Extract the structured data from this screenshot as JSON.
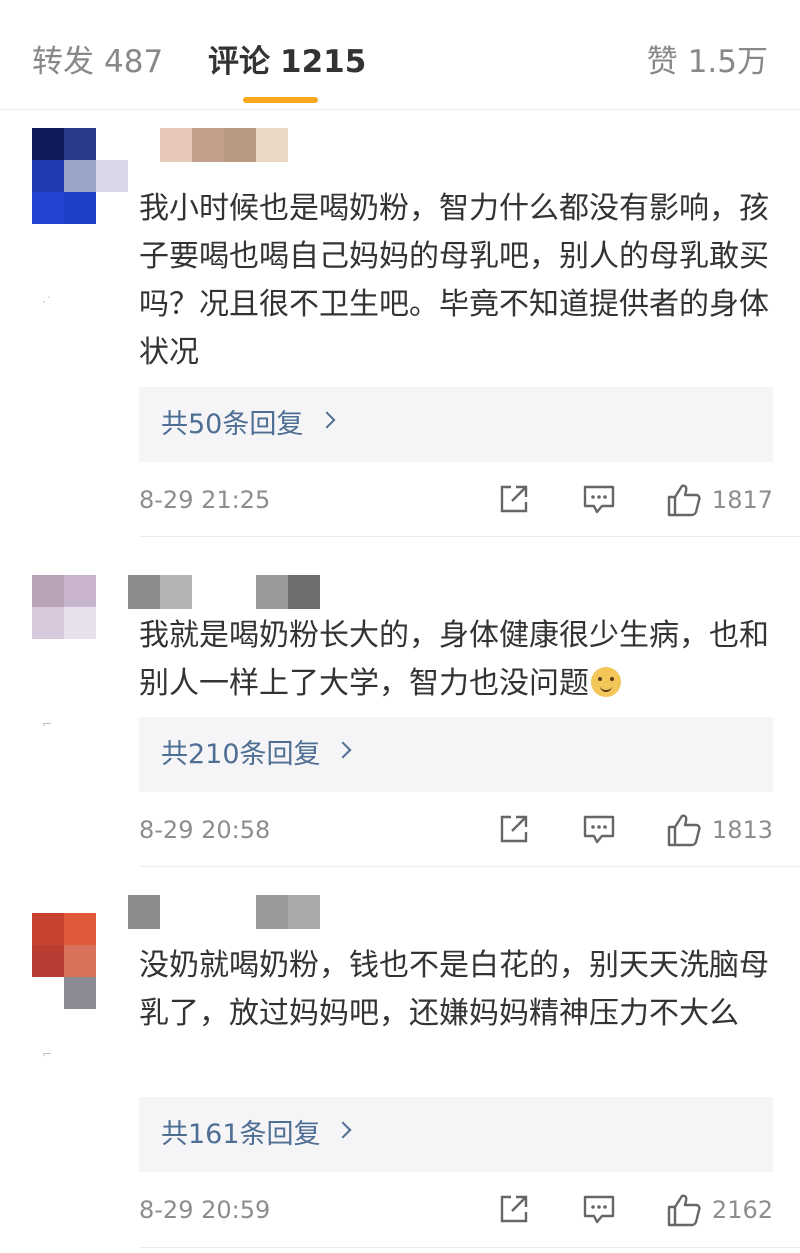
{
  "tabs": {
    "repost": {
      "label": "转发",
      "count": "487"
    },
    "comments": {
      "label": "评论",
      "count": "1215"
    },
    "likes": {
      "label": "赞",
      "count": "1.5万"
    }
  },
  "colors": {
    "active_underline": "#f8a81e",
    "reply_link": "#4e6e93",
    "meta_text": "#8d8d8d"
  },
  "comments": [
    {
      "text": "我小时候也是喝奶粉，智力什么都没有影响，孩子要喝也喝自己妈妈的母乳吧，别人的母乳敢买吗？况且很不卫生吧。毕竟不知道提供者的身体状况",
      "replies_label": "共50条回复",
      "time": "8-29 21:25",
      "likes": "1817"
    },
    {
      "text": "我就是喝奶粉长大的，身体健康很少生病，也和别人一样上了大学，智力也没问题",
      "emoji": "doge-emoji",
      "replies_label": "共210条回复",
      "time": "8-29 20:58",
      "likes": "1813"
    },
    {
      "text": "没奶就喝奶粉，钱也不是白花的，别天天洗脑母乳了，放过妈妈吧，还嫌妈妈精神压力不大么",
      "replies_label": "共161条回复",
      "time": "8-29 20:59",
      "likes": "2162"
    }
  ],
  "icons": {
    "repost": "share-icon",
    "comment": "comment-icon",
    "like": "thumbs-up-icon"
  }
}
